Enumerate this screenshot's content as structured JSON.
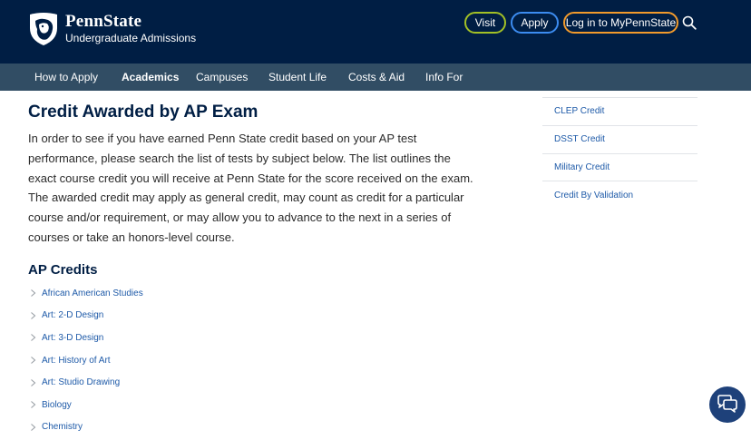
{
  "header": {
    "brand_name": "PennState",
    "brand_sub": "Undergraduate Admissions",
    "visit_label": "Visit",
    "apply_label": "Apply",
    "login_label": "Log in to MyPennState",
    "colors": {
      "bg": "#001e44",
      "visit": "#a2c026",
      "apply": "#3c8cf0",
      "login": "#f19a2c"
    }
  },
  "nav": {
    "items": [
      {
        "label": "How to Apply"
      },
      {
        "label": "Academics"
      },
      {
        "label": "Campuses"
      },
      {
        "label": "Student Life"
      },
      {
        "label": "Costs & Aid"
      },
      {
        "label": "Info For"
      }
    ],
    "active": "Academics"
  },
  "main": {
    "title": "Credit Awarded by AP Exam",
    "intro": "In order to see if you have earned Penn State credit based on your AP test performance, please search the list of tests by subject below. The list outlines the exact course credit you will receive at Penn State for the score received on the exam. The awarded credit may apply as general credit, may count as credit for a particular course and/or requirement, or may allow you to advance to the next in a series of courses or take an honors-level course.",
    "section_title": "AP Credits",
    "ap_items": [
      "African American Studies",
      "Art: 2-D Design",
      "Art: 3-D Design",
      "Art: History of Art",
      "Art: Studio Drawing",
      "Biology",
      "Chemistry"
    ]
  },
  "sidebar": {
    "items": [
      "CLEP Credit",
      "DSST Credit",
      "Military Credit",
      "Credit By Validation"
    ]
  }
}
